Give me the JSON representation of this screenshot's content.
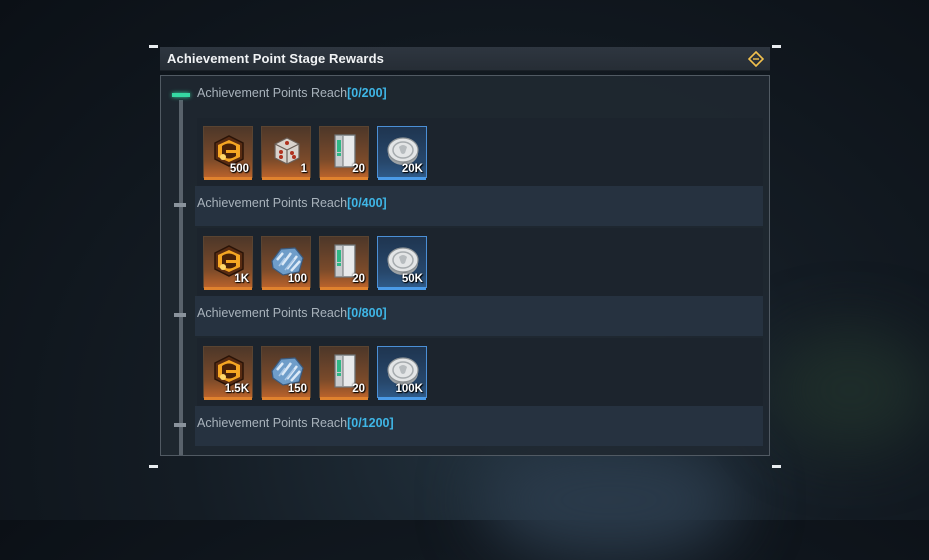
{
  "window": {
    "title": "Achievement Point Stage Rewards",
    "icon": "diamond-link-icon"
  },
  "stages": [
    {
      "label": "Achievement Points Reach",
      "progress": "[0/200]",
      "active": true,
      "rewards": [
        {
          "icon": "achievement-crate-icon",
          "qty": "500",
          "frame": "orange"
        },
        {
          "icon": "dice-icon",
          "qty": "1",
          "frame": "orange"
        },
        {
          "icon": "door-card-icon",
          "qty": "20",
          "frame": "orange"
        },
        {
          "icon": "silver-coin-icon",
          "qty": "20K",
          "frame": "blue"
        }
      ]
    },
    {
      "label": "Achievement Points Reach",
      "progress": "[0/400]",
      "active": false,
      "rewards": [
        {
          "icon": "achievement-crate-icon",
          "qty": "1K",
          "frame": "orange"
        },
        {
          "icon": "crystal-ore-icon",
          "qty": "100",
          "frame": "orange"
        },
        {
          "icon": "door-card-icon",
          "qty": "20",
          "frame": "orange"
        },
        {
          "icon": "silver-coin-icon",
          "qty": "50K",
          "frame": "blue"
        }
      ]
    },
    {
      "label": "Achievement Points Reach",
      "progress": "[0/800]",
      "active": false,
      "rewards": [
        {
          "icon": "achievement-crate-icon",
          "qty": "1.5K",
          "frame": "orange"
        },
        {
          "icon": "crystal-ore-icon",
          "qty": "150",
          "frame": "orange"
        },
        {
          "icon": "door-card-icon",
          "qty": "20",
          "frame": "orange"
        },
        {
          "icon": "silver-coin-icon",
          "qty": "100K",
          "frame": "blue"
        }
      ]
    },
    {
      "label": "Achievement Points Reach",
      "progress": "[0/1200]",
      "active": false,
      "rewards": []
    }
  ],
  "colors": {
    "accent": "#3fb6e6",
    "active_marker": "#35d9a2",
    "orange_frame": "#e0822e",
    "blue_frame": "#4b9be8"
  }
}
